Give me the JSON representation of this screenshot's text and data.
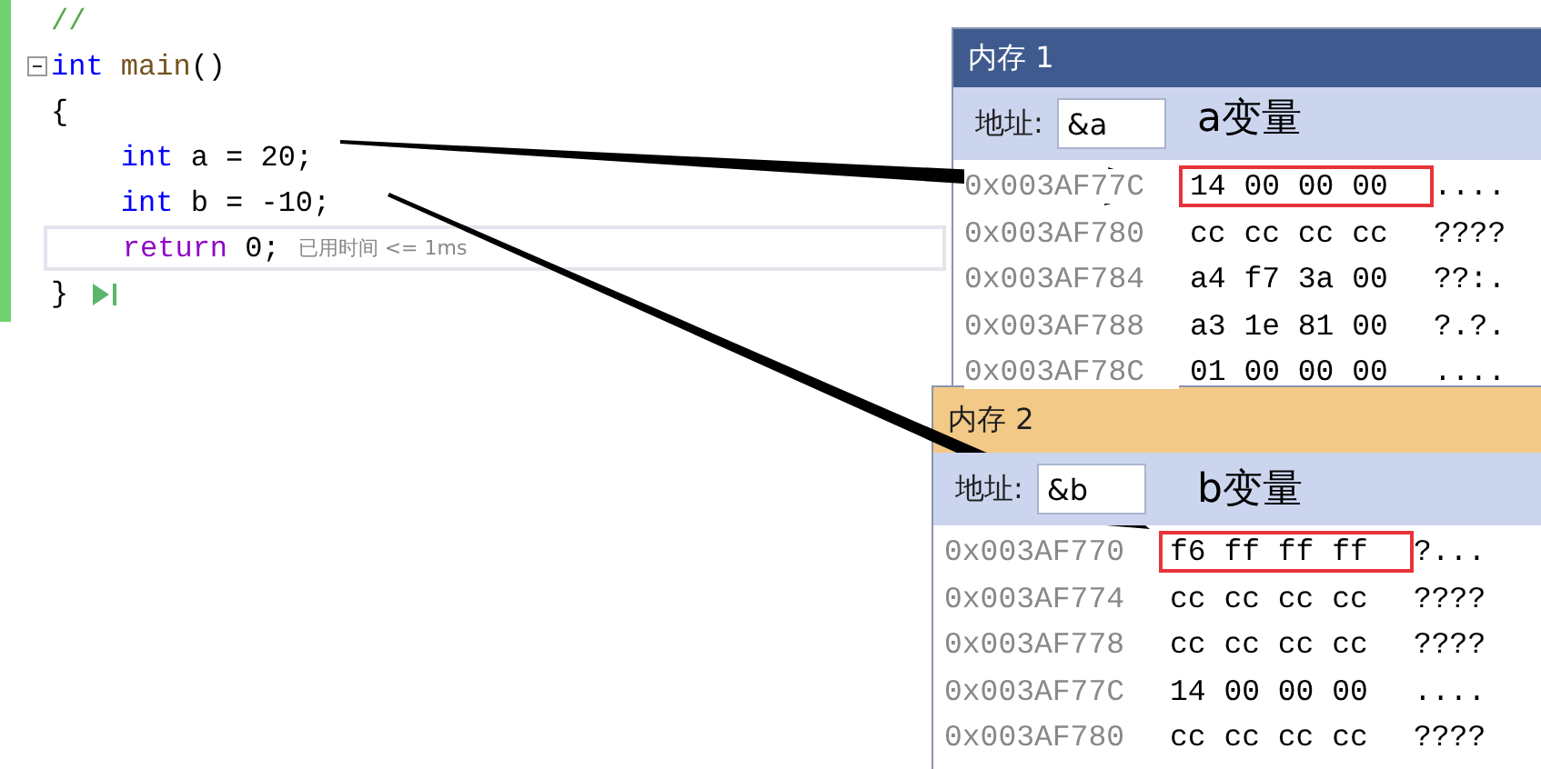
{
  "editor": {
    "lines": [
      {
        "kind": "plain",
        "current": false,
        "tokens": [
          {
            "kind": "comment",
            "text": "//"
          }
        ]
      },
      {
        "kind": "function-header",
        "current": false,
        "tokens": [
          {
            "kind": "keyword",
            "text": "int"
          },
          {
            "kind": "function",
            "text": " main"
          },
          {
            "kind": "plain",
            "text": "()"
          }
        ]
      },
      {
        "kind": "plain",
        "current": false,
        "tokens": [
          {
            "kind": "plain",
            "text": "{"
          }
        ],
        "children": [
          {
            "kind": "plain",
            "current": false,
            "tokens": [
              {
                "kind": "keyword",
                "text": "int"
              },
              {
                "kind": "plain",
                "text": " a = 20;"
              }
            ]
          },
          {
            "kind": "plain",
            "current": false,
            "tokens": [
              {
                "kind": "keyword",
                "text": "int"
              },
              {
                "kind": "plain",
                "text": " b = -10;"
              }
            ]
          },
          {
            "kind": "plain",
            "current": true,
            "tokens": [
              {
                "kind": "control",
                "text": "return"
              },
              {
                "kind": "plain",
                "text": " 0;"
              }
            ],
            "hint": "已用时间 <= 1ms"
          }
        ]
      },
      {
        "kind": "block-end",
        "current": false,
        "tokens": [
          {
            "kind": "plain",
            "text": "}"
          }
        ]
      }
    ]
  },
  "memory_windows": [
    {
      "title": "内存 1",
      "active": false,
      "address_label": "地址:",
      "address": "&a",
      "rows": [
        {
          "address": "0x003AF77C",
          "bytes": "14 00 00 00",
          "ascii": "....",
          "highlighted": true
        },
        {
          "address": "0x003AF780",
          "bytes": "cc cc cc cc",
          "ascii": "????",
          "highlighted": false
        },
        {
          "address": "0x003AF784",
          "bytes": "a4 f7 3a 00",
          "ascii": "??:.",
          "highlighted": false
        },
        {
          "address": "0x003AF788",
          "bytes": "a3 1e 81 00",
          "ascii": "?.?.",
          "highlighted": false
        },
        {
          "address": "0x003AF78C",
          "bytes": "01 00 00 00",
          "ascii": "....",
          "highlighted": false
        }
      ]
    },
    {
      "title": "内存 2",
      "active": true,
      "address_label": "地址:",
      "address": "&b",
      "rows": [
        {
          "address": "0x003AF770",
          "bytes": "f6 ff ff ff",
          "ascii": "?...",
          "highlighted": true
        },
        {
          "address": "0x003AF774",
          "bytes": "cc cc cc cc",
          "ascii": "????",
          "highlighted": false
        },
        {
          "address": "0x003AF778",
          "bytes": "cc cc cc cc",
          "ascii": "????",
          "highlighted": false
        },
        {
          "address": "0x003AF77C",
          "bytes": "14 00 00 00",
          "ascii": "....",
          "highlighted": false
        },
        {
          "address": "0x003AF780",
          "bytes": "cc cc cc cc",
          "ascii": "????",
          "highlighted": false
        }
      ]
    }
  ],
  "annotations": [
    {
      "text": "a变量"
    },
    {
      "text": "b变量"
    }
  ]
}
